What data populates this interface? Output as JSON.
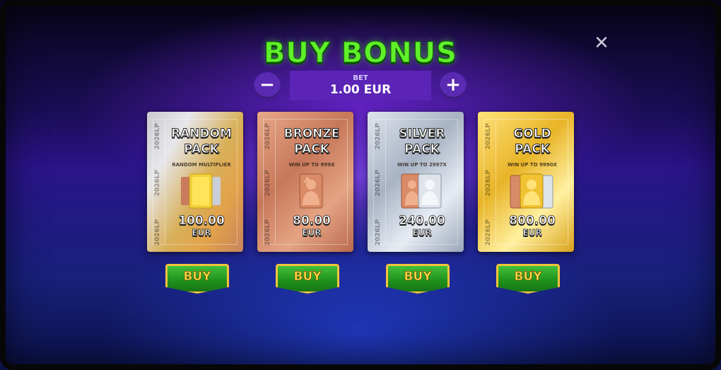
{
  "title": "BUY BONUS",
  "close_icon": "close-icon",
  "bet": {
    "label": "BET",
    "value": "1.00 EUR",
    "minus": "−",
    "plus": "+"
  },
  "spine_text": "2026LP",
  "packs": [
    {
      "name": "RANDOM\nPACK",
      "subtitle": "RANDOM MULTIPLIER",
      "price": "100.00",
      "currency": "EUR",
      "buy": "BUY",
      "theme": "mixed"
    },
    {
      "name": "BRONZE\nPACK",
      "subtitle": "WIN UP TO 999X",
      "price": "80.00",
      "currency": "EUR",
      "buy": "BUY",
      "theme": "#c7785a"
    },
    {
      "name": "SILVER\nPACK",
      "subtitle": "WIN UP TO 2997X",
      "price": "240.00",
      "currency": "EUR",
      "buy": "BUY",
      "theme": "#a8b3c4"
    },
    {
      "name": "GOLD\nPACK",
      "subtitle": "WIN UP TO 9990X",
      "price": "800.00",
      "currency": "EUR",
      "buy": "BUY",
      "theme": "#e8b428"
    }
  ],
  "colors": {
    "title_green": "#5ff02a",
    "bet_purple": "#5b24b6",
    "buy_green": "#1f8f1c",
    "buy_border": "#f2c43a"
  }
}
